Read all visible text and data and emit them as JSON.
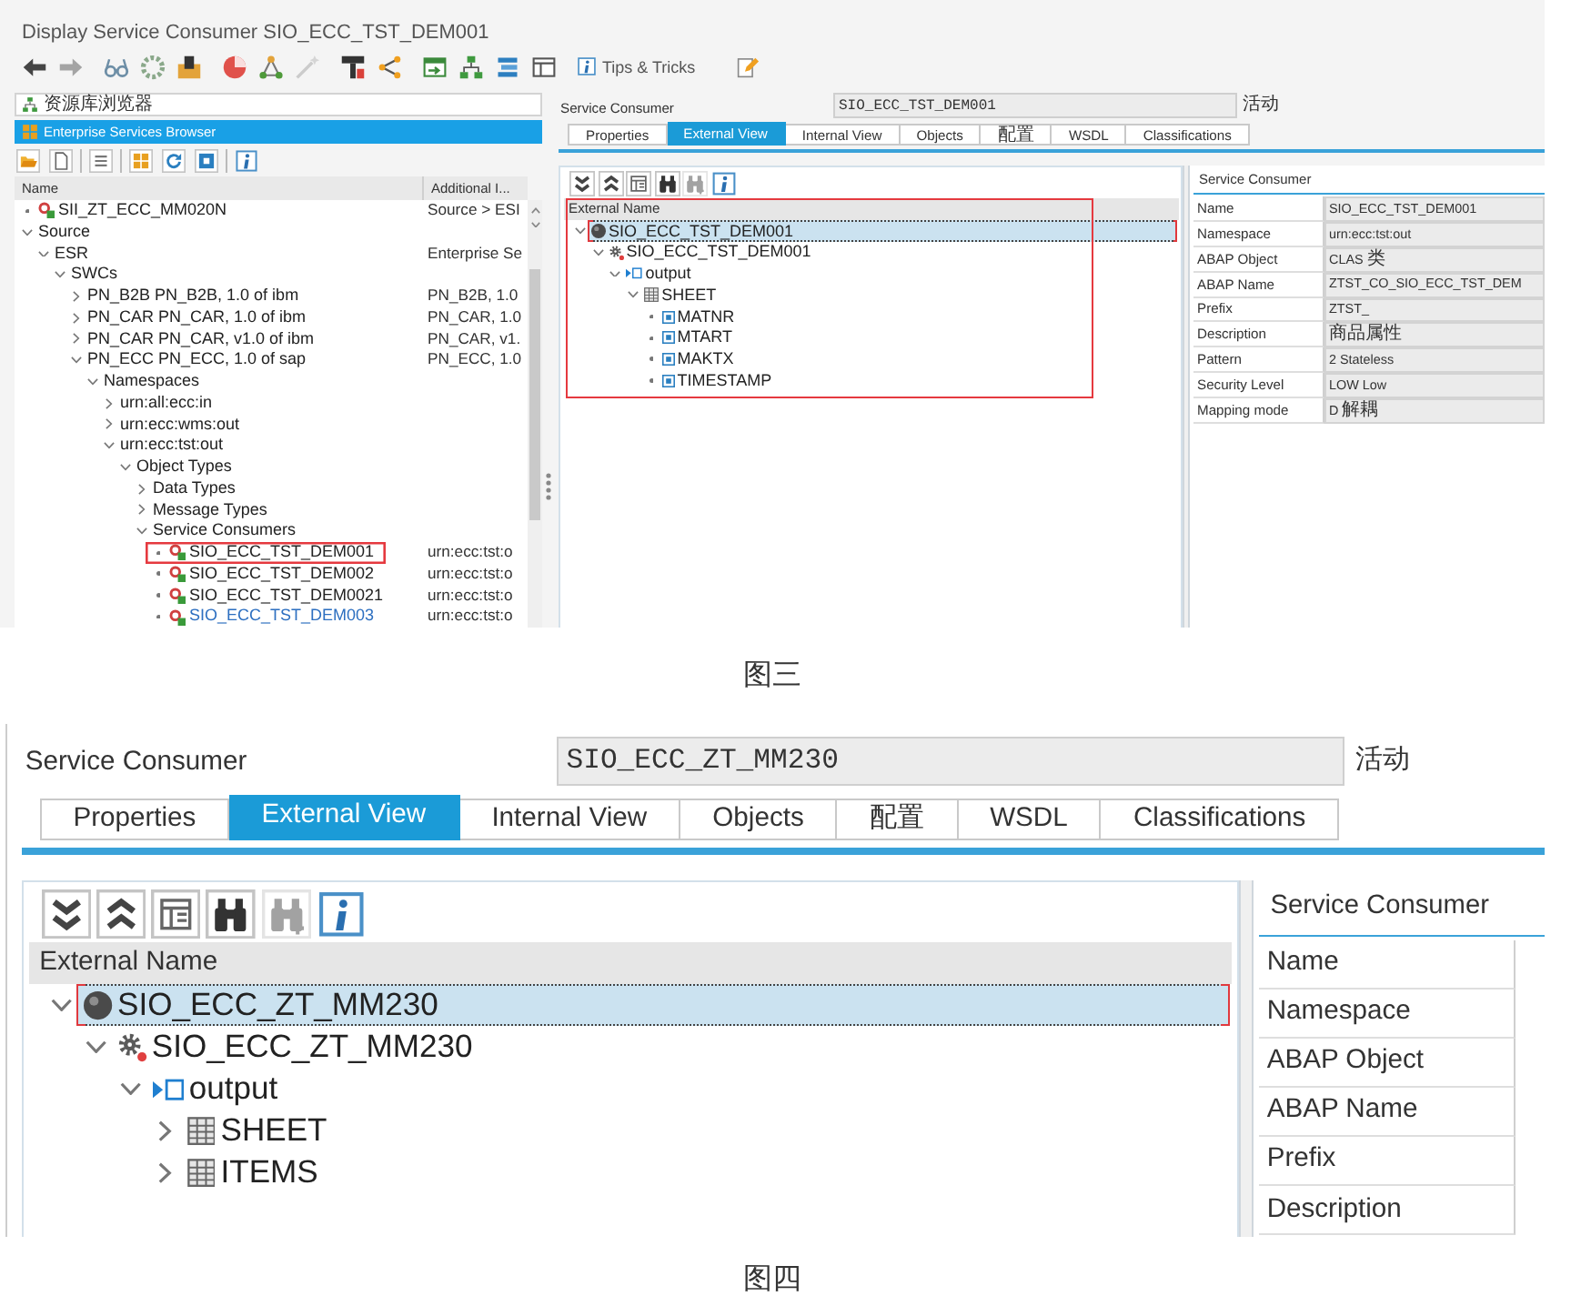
{
  "figures": [
    {
      "screenshot": {
        "window": {
          "title": "Display Service Consumer SIO_ECC_TST_DEM001"
        },
        "toolbar": {
          "groups": [
            [
              {
                "kind": "back",
                "disabled": false
              },
              {
                "kind": "forward",
                "disabled": true
              }
            ],
            [
              {
                "kind": "glasses",
                "disabled": false
              },
              {
                "kind": "ring",
                "disabled": false
              },
              {
                "kind": "package",
                "disabled": false
              }
            ],
            [
              {
                "kind": "pie",
                "disabled": false
              },
              {
                "kind": "nodes",
                "disabled": false
              },
              {
                "kind": "wand",
                "disabled": true
              }
            ],
            [
              {
                "kind": "stamp",
                "disabled": false
              },
              {
                "kind": "branch",
                "disabled": false
              }
            ],
            [
              {
                "kind": "form",
                "disabled": false
              },
              {
                "kind": "hierarchy",
                "disabled": false
              },
              {
                "kind": "stack",
                "disabled": false
              },
              {
                "kind": "window",
                "disabled": false
              }
            ]
          ],
          "tips": {
            "label": "Tips & Tricks"
          }
        },
        "browser": {
          "sections": [
            {
              "kind": "repository",
              "label": "资源库浏览器",
              "selected": false
            },
            {
              "kind": "services",
              "label": "Enterprise Services Browser",
              "selected": true
            }
          ],
          "toolbar": {
            "groups": [
              [
                {
                  "kind": "open"
                },
                {
                  "kind": "new"
                }
              ],
              [
                {
                  "kind": "list"
                }
              ],
              [
                {
                  "kind": "grid"
                },
                {
                  "kind": "refresh"
                },
                {
                  "kind": "square"
                }
              ],
              [
                {
                  "kind": "info"
                }
              ]
            ]
          },
          "columns": [
            "Name",
            "Additional I..."
          ],
          "tree": [
            {
              "label": "SII_ZT_ECC_MM020N",
              "kind": "object",
              "extra": "Source > ESI"
            },
            {
              "label": "Source",
              "kind": "folder",
              "expanded": true,
              "children": [
                {
                  "label": "ESR",
                  "kind": "folder",
                  "expanded": true,
                  "extra": "Enterprise Se",
                  "children": [
                    {
                      "label": "SWCs",
                      "kind": "folder",
                      "expanded": true,
                      "children": [
                        {
                          "label": "PN_B2B PN_B2B, 1.0 of ibm",
                          "kind": "folder",
                          "expanded": false,
                          "extra": "PN_B2B, 1.0"
                        },
                        {
                          "label": "PN_CAR PN_CAR, 1.0 of ibm",
                          "kind": "folder",
                          "expanded": false,
                          "extra": "PN_CAR, 1.0"
                        },
                        {
                          "label": "PN_CAR PN_CAR, v1.0 of ibm",
                          "kind": "folder",
                          "expanded": false,
                          "extra": "PN_CAR, v1."
                        },
                        {
                          "label": "PN_ECC PN_ECC, 1.0 of sap",
                          "kind": "folder",
                          "expanded": true,
                          "extra": "PN_ECC, 1.0",
                          "children": [
                            {
                              "label": "Namespaces",
                              "kind": "folder",
                              "expanded": true,
                              "children": [
                                {
                                  "label": "urn:all:ecc:in",
                                  "kind": "folder",
                                  "expanded": false
                                },
                                {
                                  "label": "urn:ecc:wms:out",
                                  "kind": "folder",
                                  "expanded": false
                                },
                                {
                                  "label": "urn:ecc:tst:out",
                                  "kind": "folder",
                                  "expanded": true,
                                  "children": [
                                    {
                                      "label": "Object Types",
                                      "kind": "folder",
                                      "expanded": true,
                                      "children": [
                                        {
                                          "label": "Data Types",
                                          "kind": "folder",
                                          "expanded": false
                                        },
                                        {
                                          "label": "Message Types",
                                          "kind": "folder",
                                          "expanded": false
                                        },
                                        {
                                          "label": "Service Consumers",
                                          "kind": "folder",
                                          "expanded": true,
                                          "children": [
                                            {
                                              "label": "SIO_ECC_TST_DEM001",
                                              "kind": "object",
                                              "extra": "urn:ecc:tst:o",
                                              "marked": true,
                                              "hovered": false
                                            },
                                            {
                                              "label": "SIO_ECC_TST_DEM002",
                                              "kind": "object",
                                              "extra": "urn:ecc:tst:o",
                                              "marked": false,
                                              "hovered": false
                                            },
                                            {
                                              "label": "SIO_ECC_TST_DEM0021",
                                              "kind": "object",
                                              "extra": "urn:ecc:tst:o",
                                              "marked": false,
                                              "hovered": false
                                            },
                                            {
                                              "label": "SIO_ECC_TST_DEM003",
                                              "kind": "object",
                                              "extra": "urn:ecc:tst:o",
                                              "marked": false,
                                              "hovered": true
                                            }
                                          ]
                                        }
                                      ]
                                    }
                                  ]
                                }
                              ]
                            }
                          ]
                        }
                      ]
                    }
                  ]
                }
              ]
            }
          ]
        },
        "editor": {
          "object_label": "Service Consumer",
          "object_name": "SIO_ECC_TST_DEM001",
          "status": "活动",
          "tabs": [
            {
              "label": "Properties",
              "selected": false
            },
            {
              "label": "External View",
              "selected": true
            },
            {
              "label": "Internal View",
              "selected": false
            },
            {
              "label": "Objects",
              "selected": false
            },
            {
              "label": "配置",
              "selected": false
            },
            {
              "label": "WSDL",
              "selected": false
            },
            {
              "label": "Classifications",
              "selected": false
            }
          ],
          "toolbar": [
            {
              "kind": "expand",
              "disabled": false
            },
            {
              "kind": "collapse",
              "disabled": false
            },
            {
              "kind": "columns",
              "disabled": false
            },
            {
              "kind": "find",
              "disabled": false
            },
            {
              "kind": "findnext",
              "disabled": true
            },
            {
              "kind": "info",
              "disabled": false
            }
          ],
          "tree": {
            "column": "External Name",
            "marked": true,
            "nodes": [
              {
                "label": "SIO_ECC_TST_DEM001",
                "kind": "interface",
                "expanded": true,
                "selected": true,
                "children": [
                  {
                    "label": "SIO_ECC_TST_DEM001",
                    "kind": "operation",
                    "expanded": true,
                    "selected": false,
                    "children": [
                      {
                        "label": "output",
                        "kind": "message",
                        "expanded": true,
                        "selected": false,
                        "children": [
                          {
                            "label": "SHEET",
                            "kind": "table",
                            "expanded": true,
                            "selected": false,
                            "children": [
                              {
                                "label": "MATNR",
                                "kind": "field",
                                "selected": false
                              },
                              {
                                "label": "MTART",
                                "kind": "field",
                                "selected": false
                              },
                              {
                                "label": "MAKTX",
                                "kind": "field",
                                "selected": false
                              },
                              {
                                "label": "TIMESTAMP",
                                "kind": "field",
                                "selected": false
                              }
                            ]
                          }
                        ]
                      }
                    ]
                  }
                ]
              }
            ]
          },
          "details": {
            "title": "Service Consumer",
            "rows": [
              {
                "label": "Name",
                "value": "SIO_ECC_TST_DEM001"
              },
              {
                "label": "Namespace",
                "value": "urn:ecc:tst:out"
              },
              {
                "label": "ABAP Object",
                "value": "CLAS 类"
              },
              {
                "label": "ABAP Name",
                "value": "ZTST_CO_SIO_ECC_TST_DEM"
              },
              {
                "label": "Prefix",
                "value": "ZTST_"
              },
              {
                "label": "Description",
                "value": "商品属性"
              },
              {
                "label": "Pattern",
                "value": "2 Stateless"
              },
              {
                "label": "Security Level",
                "value": "LOW Low"
              },
              {
                "label": "Mapping mode",
                "value": "D 解耦"
              }
            ]
          }
        }
      },
      "caption": "图三"
    },
    {
      "screenshot": {
        "editor": {
          "object_label": "Service Consumer",
          "object_name": "SIO_ECC_ZT_MM230",
          "status": "活动",
          "tabs": [
            {
              "label": "Properties",
              "selected": false
            },
            {
              "label": "External View",
              "selected": true
            },
            {
              "label": "Internal View",
              "selected": false
            },
            {
              "label": "Objects",
              "selected": false
            },
            {
              "label": "配置",
              "selected": false
            },
            {
              "label": "WSDL",
              "selected": false
            },
            {
              "label": "Classifications",
              "selected": false
            }
          ],
          "toolbar": [
            {
              "kind": "expand",
              "disabled": false
            },
            {
              "kind": "collapse",
              "disabled": false
            },
            {
              "kind": "columns",
              "disabled": false
            },
            {
              "kind": "find",
              "disabled": false
            },
            {
              "kind": "findnext",
              "disabled": true
            },
            {
              "kind": "info",
              "disabled": false
            }
          ],
          "tree": {
            "column": "External Name",
            "nodes": [
              {
                "label": "SIO_ECC_ZT_MM230",
                "kind": "interface",
                "expanded": true,
                "selected": true,
                "children": [
                  {
                    "label": "SIO_ECC_ZT_MM230",
                    "kind": "operation",
                    "expanded": true,
                    "selected": false,
                    "children": [
                      {
                        "label": "output",
                        "kind": "message",
                        "expanded": true,
                        "selected": false,
                        "children": [
                          {
                            "label": "SHEET",
                            "kind": "table",
                            "expanded": false,
                            "selected": false
                          },
                          {
                            "label": "ITEMS",
                            "kind": "table",
                            "expanded": false,
                            "selected": false
                          }
                        ]
                      }
                    ]
                  }
                ]
              }
            ]
          },
          "details": {
            "title": "Service Consumer",
            "rows": [
              {
                "label": "Name"
              },
              {
                "label": "Namespace"
              },
              {
                "label": "ABAP Object"
              },
              {
                "label": "ABAP Name"
              },
              {
                "label": "Prefix"
              },
              {
                "label": "Description"
              }
            ]
          }
        }
      },
      "caption": "图四"
    }
  ]
}
